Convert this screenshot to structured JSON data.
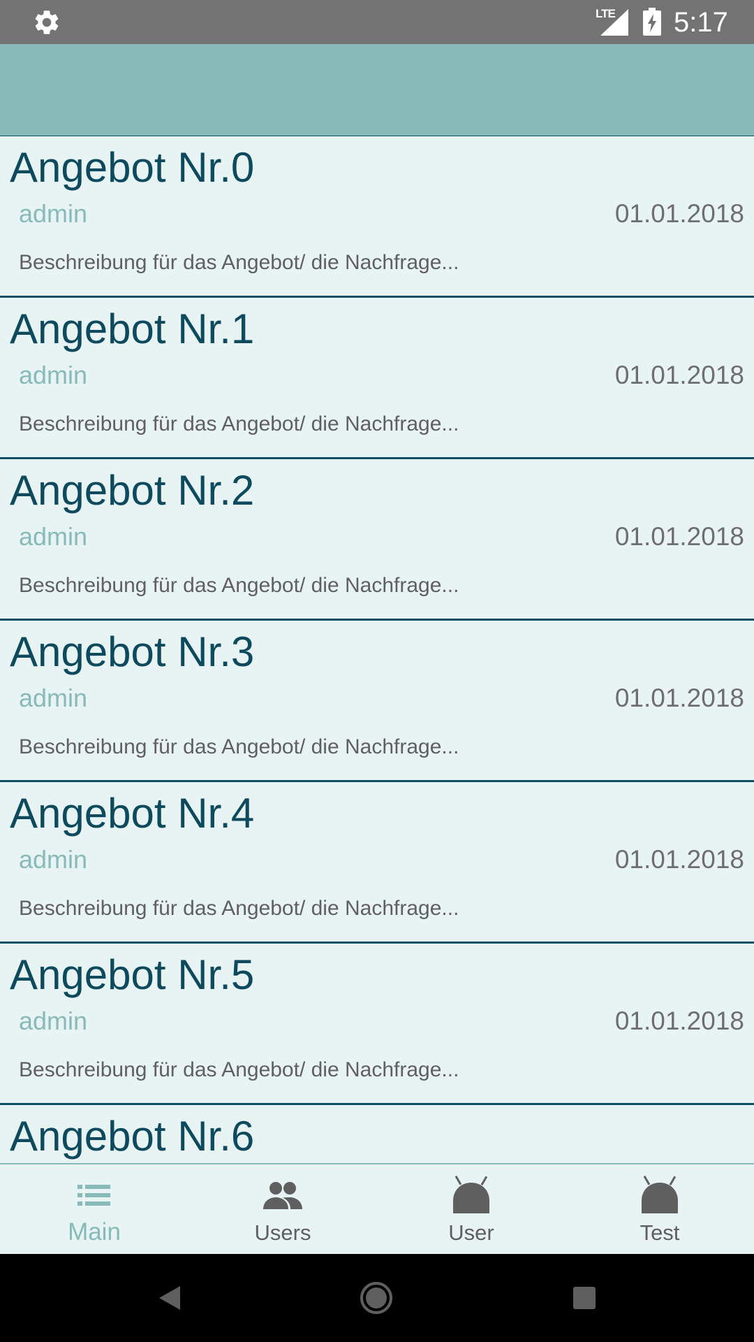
{
  "status_bar": {
    "network": "LTE",
    "time": "5:17",
    "icons": [
      "gear-icon",
      "signal-icon",
      "battery-charging-icon"
    ]
  },
  "list": {
    "items": [
      {
        "title": "Angebot Nr.0",
        "author": "admin",
        "date": "01.01.2018",
        "description": "Beschreibung für das Angebot/ die Nachfrage..."
      },
      {
        "title": "Angebot Nr.1",
        "author": "admin",
        "date": "01.01.2018",
        "description": "Beschreibung für das Angebot/ die Nachfrage..."
      },
      {
        "title": "Angebot Nr.2",
        "author": "admin",
        "date": "01.01.2018",
        "description": "Beschreibung für das Angebot/ die Nachfrage..."
      },
      {
        "title": "Angebot Nr.3",
        "author": "admin",
        "date": "01.01.2018",
        "description": "Beschreibung für das Angebot/ die Nachfrage..."
      },
      {
        "title": "Angebot Nr.4",
        "author": "admin",
        "date": "01.01.2018",
        "description": "Beschreibung für das Angebot/ die Nachfrage..."
      },
      {
        "title": "Angebot Nr.5",
        "author": "admin",
        "date": "01.01.2018",
        "description": "Beschreibung für das Angebot/ die Nachfrage..."
      },
      {
        "title": "Angebot Nr.6"
      }
    ]
  },
  "bottom_nav": {
    "items": [
      {
        "label": "Main",
        "icon": "list-icon",
        "active": true
      },
      {
        "label": "Users",
        "icon": "people-icon",
        "active": false
      },
      {
        "label": "User",
        "icon": "android-icon",
        "active": false
      },
      {
        "label": "Test",
        "icon": "android-icon",
        "active": false
      }
    ]
  },
  "system_nav": {
    "icons": [
      "back-icon",
      "home-icon",
      "recents-icon"
    ]
  },
  "colors": {
    "status_bar": "#737373",
    "app_bar": "#87bab8",
    "list_background": "#e8f4f4",
    "title_text": "#0d4a5e",
    "divider": "#0d4f63",
    "author_text": "#87bab8",
    "nav_active": "#87bab8",
    "nav_inactive": "#5f5f5f"
  }
}
